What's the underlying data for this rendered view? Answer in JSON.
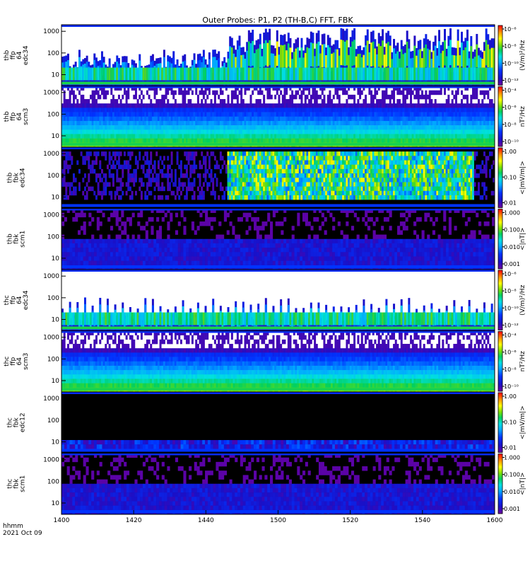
{
  "title": "Outer Probes: P1, P2 (TH-B,C) FFT, FBK",
  "time_axis": {
    "ticks": [
      "1400",
      "1420",
      "1440",
      "1500",
      "1520",
      "1540",
      "1600"
    ],
    "footer_label": "hhmm",
    "date": "2021 Oct 09"
  },
  "chart_data": {
    "type": "heatmap",
    "title": "Outer Probes: P1, P2 (TH-B,C) FFT, FBK",
    "x_range": [
      "14:00",
      "16:00"
    ],
    "x_tick_labels": [
      "1400",
      "1420",
      "1440",
      "1500",
      "1520",
      "1540",
      "1600"
    ],
    "panels": [
      {
        "ylabel": [
          "thb",
          "ffp",
          "64",
          "edc34"
        ],
        "y_scale": "log",
        "y_ticks": [
          "10",
          "100",
          "1000"
        ],
        "colorbar_label": "(V/m)²/Hz",
        "colorbar_ticks": [
          "10⁻⁶",
          "10⁻⁸",
          "10⁻¹⁰",
          "10⁻¹²"
        ],
        "colorscale": "log",
        "pattern": "ffp-active"
      },
      {
        "ylabel": [
          "thb",
          "ffp",
          "64",
          "scm3"
        ],
        "y_scale": "log",
        "y_ticks": [
          "10",
          "100",
          "1000"
        ],
        "colorbar_label": "nT²/Hz",
        "colorbar_ticks": [
          "10⁻⁴",
          "10⁻⁶",
          "10⁻⁸",
          "10⁻¹⁰"
        ],
        "colorscale": "log",
        "pattern": "scm-ffp"
      },
      {
        "ylabel": [
          "thb",
          "fbk",
          "edc34"
        ],
        "y_scale": "log",
        "y_ticks": [
          "10",
          "100",
          "1000"
        ],
        "colorbar_label": "<|mV/m|>",
        "colorbar_ticks": [
          "1.00",
          "0.10",
          "0.01"
        ],
        "colorscale": "log",
        "pattern": "fbk-active"
      },
      {
        "ylabel": [
          "thb",
          "fbk",
          "scm1"
        ],
        "y_scale": "log",
        "y_ticks": [
          "10",
          "100",
          "1000"
        ],
        "colorbar_label": "<|nT|>",
        "colorbar_ticks": [
          "1.000",
          "0.100",
          "0.010",
          "0.001"
        ],
        "colorscale": "log",
        "pattern": "fbk-quiet"
      },
      {
        "ylabel": [
          "thc",
          "ffp",
          "64",
          "edc34"
        ],
        "y_scale": "log",
        "y_ticks": [
          "10",
          "100",
          "1000"
        ],
        "colorbar_label": "(V/m)²/Hz",
        "colorbar_ticks": [
          "10⁻⁶",
          "10⁻⁸",
          "10⁻¹⁰",
          "10⁻¹²"
        ],
        "colorscale": "log",
        "pattern": "ffp-spiky"
      },
      {
        "ylabel": [
          "thc",
          "ffp",
          "64",
          "scm3"
        ],
        "y_scale": "log",
        "y_ticks": [
          "10",
          "100",
          "1000"
        ],
        "colorbar_label": "nT²/Hz",
        "colorbar_ticks": [
          "10⁻⁴",
          "10⁻⁶",
          "10⁻⁸",
          "10⁻¹⁰"
        ],
        "colorscale": "log",
        "pattern": "scm-ffp"
      },
      {
        "ylabel": [
          "thc",
          "fbk",
          "edc12"
        ],
        "y_scale": "log",
        "y_ticks": [
          "10",
          "100",
          "1000"
        ],
        "colorbar_label": "<|mV/m|>",
        "colorbar_ticks": [
          "1.00",
          "0.10",
          "0.01"
        ],
        "colorscale": "log",
        "pattern": "fbk-dark"
      },
      {
        "ylabel": [
          "thc",
          "fbk",
          "scm1"
        ],
        "y_scale": "log",
        "y_ticks": [
          "10",
          "100",
          "1000"
        ],
        "colorbar_label": "<|nT|>",
        "colorbar_ticks": [
          "1.000",
          "0.100",
          "0.010",
          "0.001"
        ],
        "colorscale": "log",
        "pattern": "fbk-quiet"
      }
    ]
  }
}
